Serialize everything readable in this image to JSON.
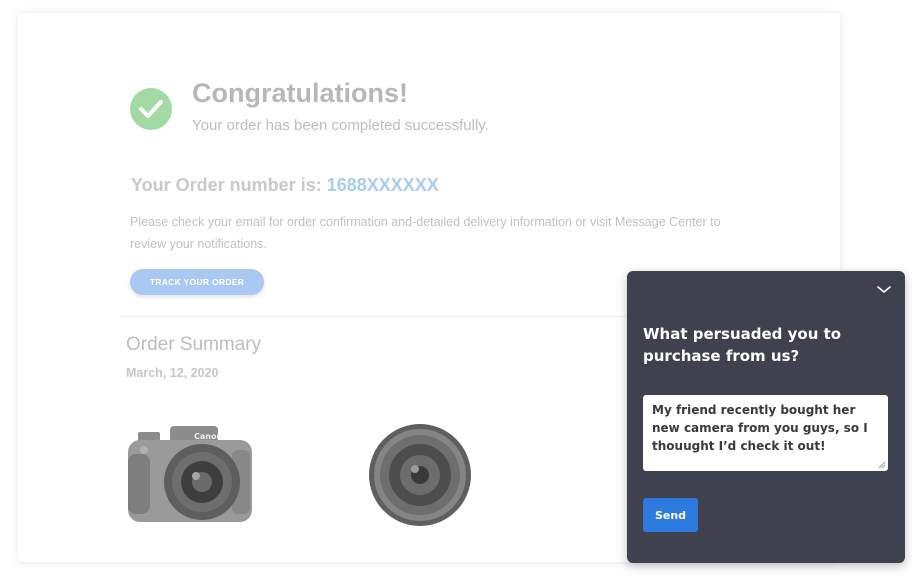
{
  "confirmation": {
    "title": "Congratulations!",
    "subtitle": "Your order has been completed successfully.",
    "order_label": "Your Order number is:",
    "order_number": "1688XXXXXX",
    "info_text": "Please check your email for order confirmation and-detailed delivery information or visit Message Center to review your notifications.",
    "track_button": "TRACK YOUR ORDER"
  },
  "summary": {
    "title": "Order Summary",
    "date": "March, 12, 2020",
    "products": [
      {
        "name": "camera",
        "image": "camera-image",
        "brand_mark": "Canon"
      },
      {
        "name": "lens",
        "image": "lens-image"
      }
    ]
  },
  "survey": {
    "question": "What persuaded you to purchase from us?",
    "answer": "My friend recently bought her new camera from you guys, so I thouught I’d check it out!",
    "send_label": "Send",
    "collapse_icon": "chevron-down-icon"
  },
  "colors": {
    "success": "#a3d9a5",
    "order_number": "#a9cdee",
    "track_button": "#a9c9f3",
    "widget_bg": "#3f424e",
    "send_button": "#2d7bdf"
  }
}
